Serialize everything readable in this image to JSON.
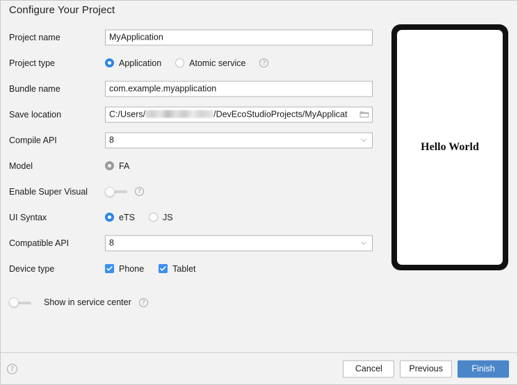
{
  "dialog": {
    "title": "Configure Your Project"
  },
  "form": {
    "project_name": {
      "label": "Project name",
      "value": "MyApplication"
    },
    "project_type": {
      "label": "Project type",
      "options": [
        {
          "label": "Application",
          "selected": true
        },
        {
          "label": "Atomic service",
          "selected": false
        }
      ],
      "help_icon": "help-circle-icon"
    },
    "bundle_name": {
      "label": "Bundle name",
      "value": "com.example.myapplication"
    },
    "save_location": {
      "label": "Save location",
      "value_prefix": "C:/Users/",
      "value_redacted": "████████",
      "value_suffix": "/DevEcoStudioProjects/MyApplicat",
      "browse_icon": "folder-open-icon"
    },
    "compile_api": {
      "label": "Compile API",
      "value": "8",
      "dropdown_icon": "chevron-down-icon"
    },
    "model": {
      "label": "Model",
      "options": [
        {
          "label": "FA",
          "selected": true,
          "disabled": true
        }
      ]
    },
    "enable_super_visual": {
      "label": "Enable Super Visual",
      "toggle_on": false,
      "help_icon": "help-circle-icon"
    },
    "ui_syntax": {
      "label": "UI Syntax",
      "options": [
        {
          "label": "eTS",
          "selected": true
        },
        {
          "label": "JS",
          "selected": false
        }
      ]
    },
    "compatible_api": {
      "label": "Compatible API",
      "value": "8",
      "dropdown_icon": "chevron-down-icon"
    },
    "device_type": {
      "label": "Device type",
      "options": [
        {
          "label": "Phone",
          "checked": true
        },
        {
          "label": "Tablet",
          "checked": true
        }
      ]
    },
    "show_in_service_center": {
      "label": "Show in service center",
      "toggle_on": false,
      "help_icon": "help-circle-icon"
    }
  },
  "preview": {
    "text": "Hello World"
  },
  "footer": {
    "help_icon": "help-circle-icon",
    "help_glyph": "?",
    "cancel_label": "Cancel",
    "previous_label": "Previous",
    "finish_label": "Finish"
  },
  "glyphs": {
    "question": "?"
  },
  "colors": {
    "accent_blue": "#2a86e8",
    "checkbox_blue": "#3b8ef0",
    "finish_blue": "#4a86c8",
    "background": "#f2f2f2",
    "field_border": "#b4b4b4"
  }
}
